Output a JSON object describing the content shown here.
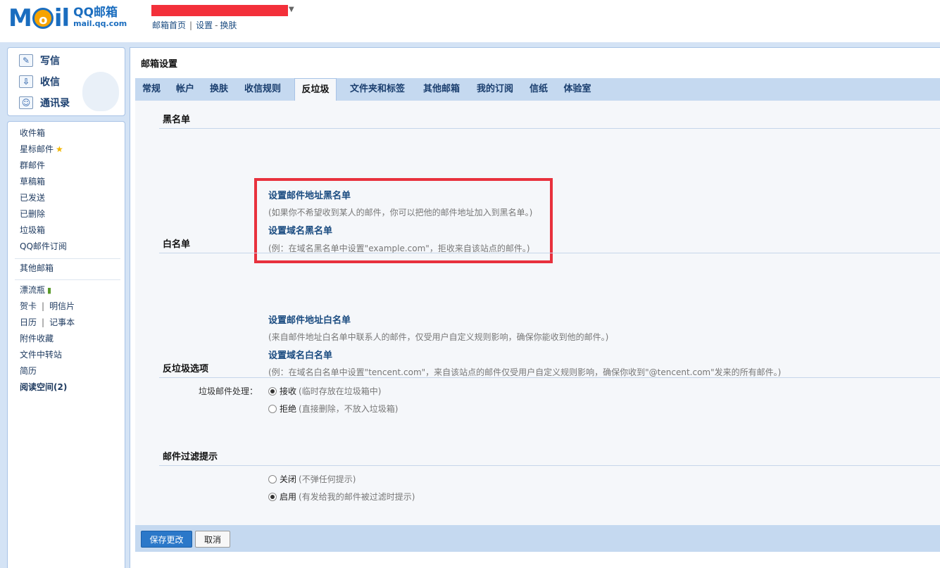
{
  "header": {
    "logo_mail": "M",
    "logo_o": "o",
    "logo_il": "il",
    "logo_title": "QQ邮箱",
    "logo_domain": "mail.qq.com",
    "top_links": [
      "邮箱首页",
      "设置",
      "换肤"
    ],
    "link_sep": "|",
    "link_dash": "-"
  },
  "sidebar": {
    "actions": [
      {
        "label": "写信",
        "icon": "pencil-icon"
      },
      {
        "label": "收信",
        "icon": "inbox-download-icon"
      },
      {
        "label": "通讯录",
        "icon": "contacts-card-icon"
      }
    ],
    "folders": [
      "收件箱",
      "星标邮件",
      "群邮件",
      "草稿箱",
      "已发送",
      "已删除",
      "垃圾箱",
      "QQ邮件订阅"
    ],
    "other_mailbox": "其他邮箱",
    "apps": {
      "bottle": "漂流瓶",
      "card": "贺卡",
      "postcard": "明信片",
      "calendar": "日历",
      "notes": "记事本",
      "attachments": "附件收藏",
      "transfer": "文件中转站",
      "resume": "简历",
      "reading": "阅读空间(2)"
    },
    "pipe": "|"
  },
  "main": {
    "title": "邮箱设置",
    "tabs": [
      "常规",
      "帐户",
      "换肤",
      "收信规则",
      "反垃圾",
      "文件夹和标签",
      "其他邮箱",
      "我的订阅",
      "信纸",
      "体验室"
    ],
    "active_tab": "反垃圾",
    "blacklist": {
      "title": "黑名单",
      "address_link": "设置邮件地址黑名单",
      "address_hint": "(如果你不希望收到某人的邮件，你可以把他的邮件地址加入到黑名单。)",
      "domain_link": "设置域名黑名单",
      "domain_hint": "(例：在域名黑名单中设置\"example.com\"，拒收来自该站点的邮件。)"
    },
    "whitelist": {
      "title": "白名单",
      "address_link": "设置邮件地址白名单",
      "address_hint": "(来自邮件地址白名单中联系人的邮件，仅受用户自定义规则影响，确保你能收到他的邮件。)",
      "domain_link": "设置域名白名单",
      "domain_hint": "(例：在域名白名单中设置\"tencent.com\"，来自该站点的邮件仅受用户自定义规则影响，确保你收到\"@tencent.com\"发来的所有邮件。)"
    },
    "antispam": {
      "title": "反垃圾选项",
      "label": "垃圾邮件处理：",
      "options": [
        {
          "label": "接收",
          "note": "(临时存放在垃圾箱中)",
          "selected": true
        },
        {
          "label": "拒绝",
          "note": "(直接删除，不放入垃圾箱)",
          "selected": false
        }
      ]
    },
    "filter_notice": {
      "title": "邮件过滤提示",
      "options": [
        {
          "label": "关闭",
          "note": "(不弹任何提示)",
          "selected": false
        },
        {
          "label": "启用",
          "note": "(有发给我的邮件被过滤时提示)",
          "selected": true
        }
      ]
    },
    "buttons": {
      "save": "保存更改",
      "cancel": "取消"
    }
  },
  "colors": {
    "accent": "#2b78c9",
    "frame": "#d4e3f5",
    "highlight": "#e8313d",
    "link": "#1a4b80"
  }
}
